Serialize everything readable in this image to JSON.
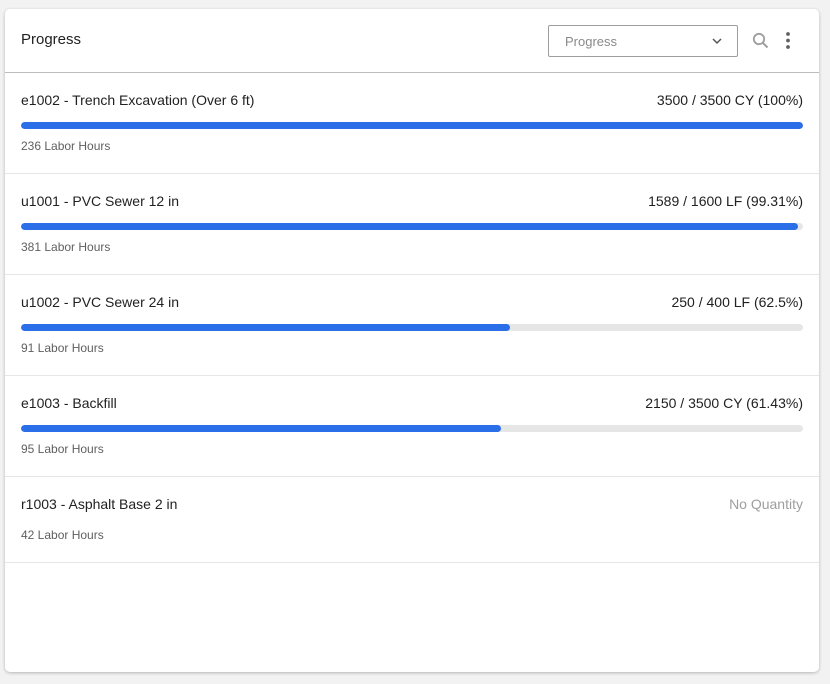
{
  "header": {
    "title": "Progress",
    "select_value": "Progress",
    "icons": [
      "search-icon",
      "more-vert-icon",
      "chevron-down-icon"
    ]
  },
  "colors": {
    "accent": "#2a6ee8",
    "track": "#e6e6e6"
  },
  "items": [
    {
      "name": "e1002 - Trench Excavation (Over 6 ft)",
      "quantity": "3500 / 3500 CY (100%)",
      "progress": 1.0,
      "hours": "236 Labor Hours"
    },
    {
      "name": "u1001 - PVC Sewer 12 in",
      "quantity": "1589 / 1600 LF (99.31%)",
      "progress": 0.9931,
      "hours": "381 Labor Hours"
    },
    {
      "name": "u1002 - PVC Sewer 24 in",
      "quantity": "250 / 400 LF (62.5%)",
      "progress": 0.625,
      "hours": "91 Labor Hours"
    },
    {
      "name": "e1003 - Backfill",
      "quantity": "2150 / 3500 CY (61.43%)",
      "progress": 0.6143,
      "hours": "95 Labor Hours"
    },
    {
      "name": "r1003 - Asphalt Base 2 in",
      "quantity": "No Quantity",
      "progress": null,
      "hours": "42 Labor Hours"
    }
  ]
}
